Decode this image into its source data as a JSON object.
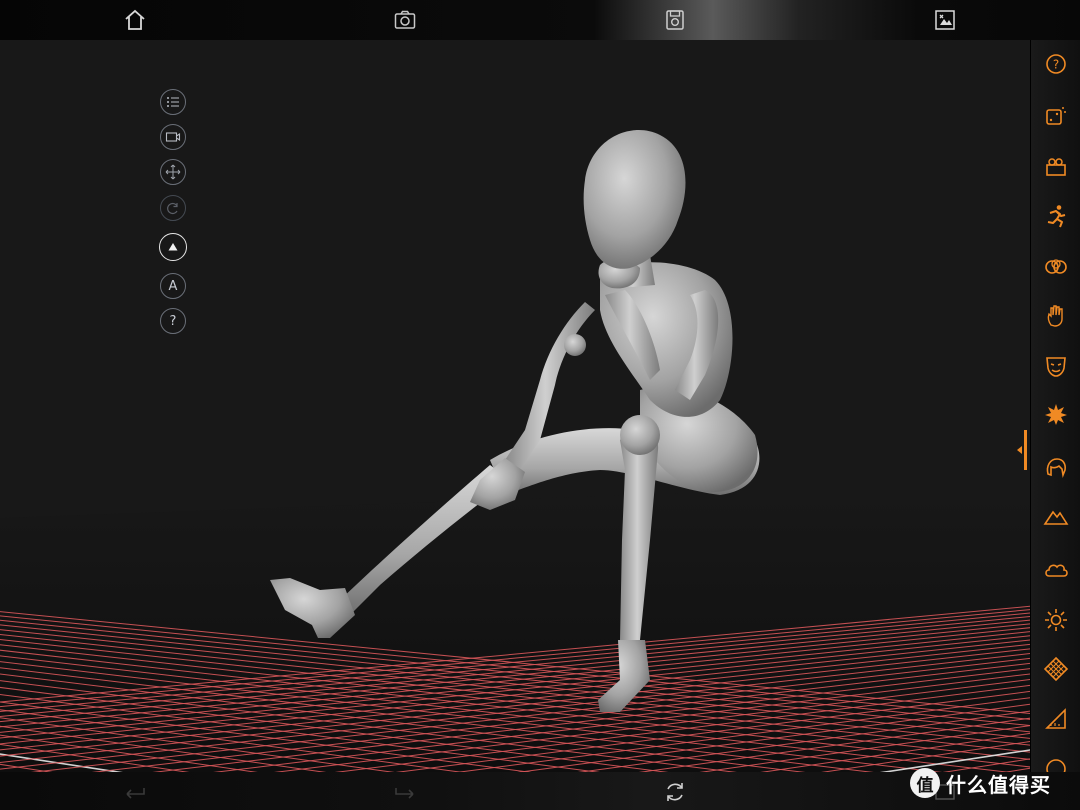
{
  "colors": {
    "accent": "#f08a24",
    "grid_red": "#d9575a",
    "grid_axis": "#e8e8e8",
    "figure": "#a8a8a8"
  },
  "topbar": {
    "buttons": [
      {
        "name": "home-button",
        "icon": "home-icon"
      },
      {
        "name": "camera-button",
        "icon": "camera-icon"
      },
      {
        "name": "save-button",
        "icon": "save-icon"
      },
      {
        "name": "edit-image-button",
        "icon": "edit-image-icon"
      }
    ]
  },
  "left_tools": {
    "items": [
      {
        "name": "list-menu-button",
        "icon": "list-icon"
      },
      {
        "name": "camera-view-button",
        "icon": "video-camera-icon"
      },
      {
        "name": "move-button",
        "icon": "move-arrows-icon"
      },
      {
        "name": "rotate-button",
        "icon": "rotate-icon"
      },
      {
        "name": "triangle-mode-button",
        "icon": "triangle-icon"
      },
      {
        "name": "auto-button",
        "icon": "letter-a-icon",
        "label": "A"
      },
      {
        "name": "help-button-left",
        "icon": "question-icon",
        "label": "?"
      }
    ]
  },
  "right_panel": {
    "items": [
      {
        "name": "help-button",
        "icon": "question-circle-icon",
        "label": "?"
      },
      {
        "name": "random-pose-button",
        "icon": "dice-icon"
      },
      {
        "name": "scene-camera-button",
        "icon": "movie-camera-icon"
      },
      {
        "name": "pose-button",
        "icon": "running-figure-icon"
      },
      {
        "name": "body-shapes-button",
        "icon": "overlapping-circles-icon"
      },
      {
        "name": "hand-button",
        "icon": "hand-icon"
      },
      {
        "name": "expression-button",
        "icon": "mask-face-icon"
      },
      {
        "name": "effects-button",
        "icon": "burst-icon"
      },
      {
        "name": "hair-button",
        "icon": "hair-icon"
      },
      {
        "name": "background-button",
        "icon": "mountain-icon"
      },
      {
        "name": "sky-button",
        "icon": "cloud-icon"
      },
      {
        "name": "light-button",
        "icon": "sun-icon"
      },
      {
        "name": "floor-button",
        "icon": "checker-tile-icon"
      },
      {
        "name": "perspective-button",
        "icon": "ruler-triangle-icon"
      },
      {
        "name": "more-button",
        "icon": "circle-icon"
      }
    ]
  },
  "bottombar": {
    "buttons": [
      {
        "name": "undo-button",
        "icon": "undo-arrow-icon"
      },
      {
        "name": "redo-button",
        "icon": "redo-arrow-icon"
      },
      {
        "name": "reset-button",
        "icon": "refresh-icon"
      },
      {
        "name": "fullscreen-button",
        "icon": "expand-icon"
      }
    ],
    "watermark": {
      "logo": "值",
      "text": "什么值得买"
    }
  }
}
